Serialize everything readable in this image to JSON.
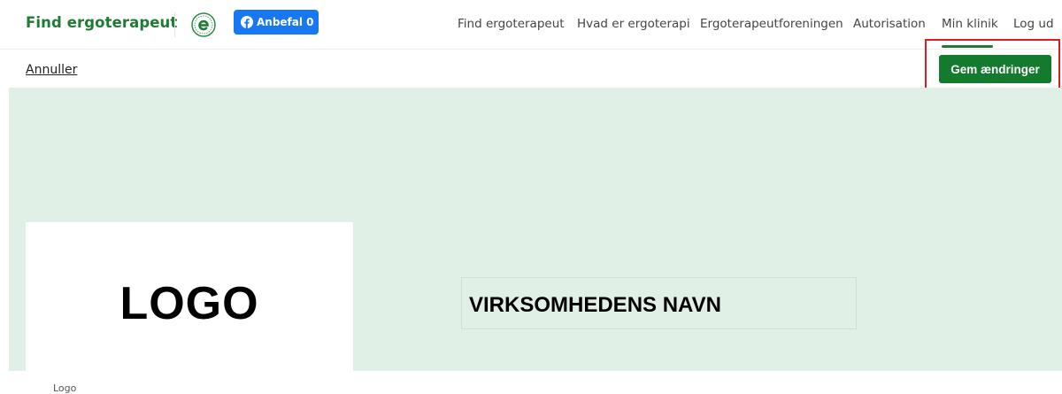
{
  "header": {
    "brand": "Find ergoterapeut",
    "facebook_button": {
      "icon": "facebook-icon",
      "label": "Anbefal 0",
      "color": "#1877f2"
    },
    "nav": [
      {
        "label": "Find ergoterapeut"
      },
      {
        "label": "Hvad er ergoterapi"
      },
      {
        "label": "Ergoterapeutforeningen"
      },
      {
        "label": "Autorisation"
      },
      {
        "label": "Min klinik",
        "active": true
      },
      {
        "label": "Log ud"
      }
    ],
    "emblem_icon": "ergoterapeut-emblem-icon"
  },
  "toolbar": {
    "cancel_label": "Annuller",
    "save_label": "Gem ændringer"
  },
  "profile": {
    "logo_placeholder": "LOGO",
    "logo_caption": "Logo",
    "company_name": "VIRKSOMHEDENS NAVN"
  },
  "colors": {
    "brand_green": "#1f7a33",
    "save_button": "#137a2e",
    "banner_bg": "#e1f0e6",
    "highlight": "#dd1c22"
  }
}
